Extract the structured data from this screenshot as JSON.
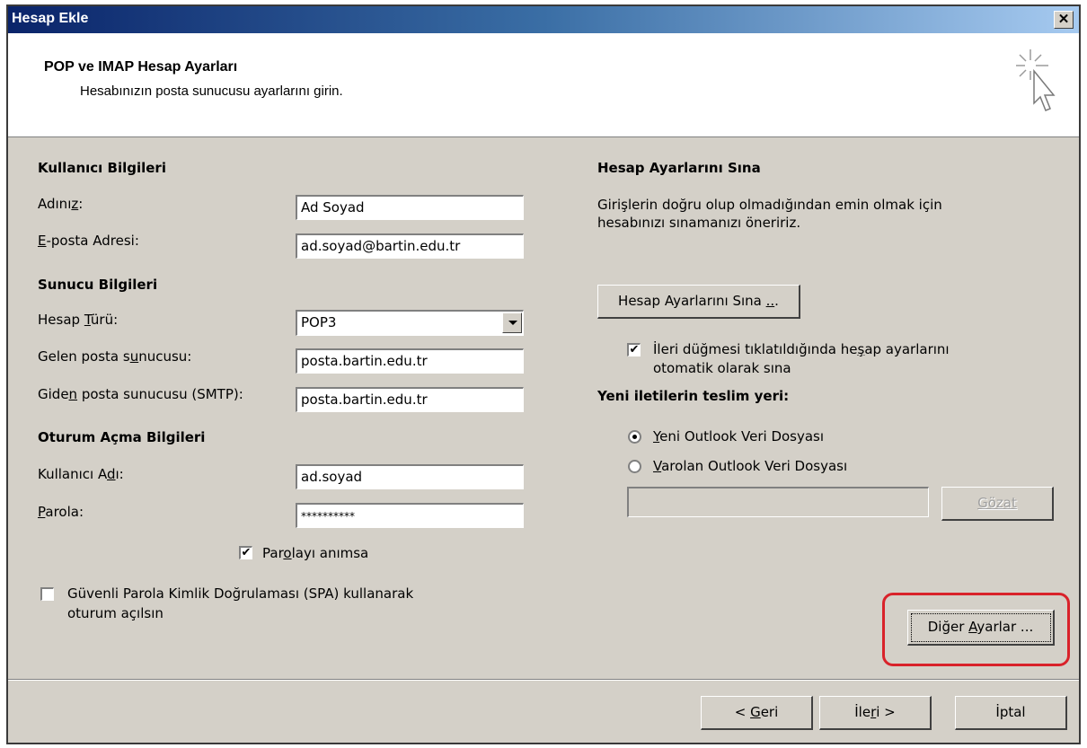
{
  "window": {
    "title": "Hesap Ekle",
    "close_label": "✕"
  },
  "header": {
    "title": "POP ve IMAP Hesap Ayarları",
    "subtitle": "Hesabınızın posta sunucusu ayarlarını girin."
  },
  "user_info": {
    "section": "Kullanıcı Bilgileri",
    "name": {
      "label_pre": "Adını",
      "label_ul": "z",
      "label_post": ":",
      "value": "Ad Soyad"
    },
    "email": {
      "label_ul": "E",
      "label_post": "-posta Adresi:",
      "value": "ad.soyad@bartin.edu.tr"
    }
  },
  "server_info": {
    "section": "Sunucu Bilgileri",
    "account_type": {
      "label_pre": "Hesap ",
      "label_ul": "T",
      "label_post": "ürü:",
      "value": "POP3"
    },
    "incoming": {
      "label_pre": "Gelen posta s",
      "label_ul": "u",
      "label_post": "nucusu:",
      "value": "posta.bartin.edu.tr"
    },
    "outgoing": {
      "label_pre": "Gide",
      "label_ul": "n",
      "label_post": " posta sunucusu (SMTP):",
      "value": "posta.bartin.edu.tr"
    }
  },
  "login_info": {
    "section": "Oturum Açma Bilgileri",
    "username": {
      "label_pre": "Kullanıcı A",
      "label_ul": "d",
      "label_post": "ı:",
      "value": "ad.soyad"
    },
    "password": {
      "label_ul": "P",
      "label_post": "arola:",
      "value": "**********"
    },
    "remember": {
      "label_pre": "Par",
      "label_ul": "o",
      "label_post": "layı anımsa",
      "checked": "✔"
    },
    "spa": {
      "line1": "Güvenli Parola Kimlik Doğrulaması (SPA) kullanarak",
      "line2": "oturum açılsın"
    }
  },
  "test_settings": {
    "section": "Hesap Ayarlarını Sına",
    "desc_line1": "Girişlerin doğru olup olmadığından emin olmak için",
    "desc_line2": "hesabınızı sınamanızı öneririz.",
    "button_pre": "Hesap Ayarlarını Sına ",
    "button_ul": "..",
    "button_post": ".",
    "auto_test_line1_pre": "İleri düğmesi tıklatıldığında he",
    "auto_test_line1_ul": "ş",
    "auto_test_line1_post": "ap ayarlarını",
    "auto_test_line2": "otomatik olarak sına",
    "auto_test_checked": "✔"
  },
  "delivery": {
    "section": "Yeni iletilerin teslim yeri:",
    "option_new_ul": "Y",
    "option_new_post": "eni Outlook Veri Dosyası",
    "option_existing_ul": "V",
    "option_existing_post": "arolan Outlook Veri Dosyası",
    "existing_path": "",
    "browse_label": "Gözat"
  },
  "other_settings": {
    "pre": "Diğer ",
    "ul": "A",
    "post": "yarlar ..."
  },
  "footer": {
    "back_pre": "< ",
    "back_ul": "G",
    "back_post": "eri",
    "next_pre": "İle",
    "next_ul": "r",
    "next_post": "i >",
    "cancel": "İptal"
  }
}
